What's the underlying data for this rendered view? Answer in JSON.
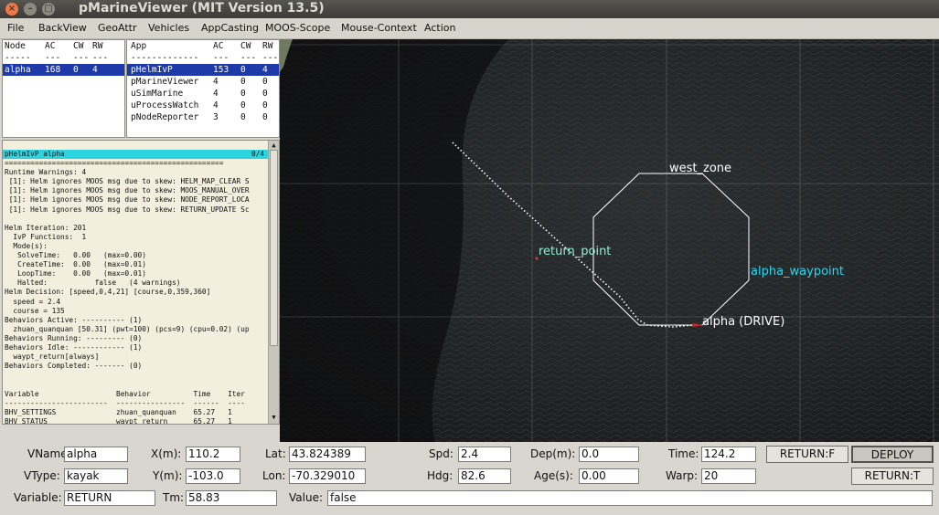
{
  "window": {
    "title": "pMarineViewer (MIT Version 13.5)"
  },
  "menu": [
    "File",
    "BackView",
    "GeoAttr",
    "Vehicles",
    "AppCasting",
    "MOOS-Scope",
    "Mouse-Context",
    "Action"
  ],
  "nodes": {
    "headers": [
      "Node",
      "AC",
      "CW",
      "RW"
    ],
    "divider": [
      "-----",
      "---",
      "---",
      "---"
    ],
    "rows": [
      [
        "alpha",
        "168",
        "0",
        "4"
      ]
    ]
  },
  "apps": {
    "headers": [
      "App",
      "AC",
      "CW",
      "RW"
    ],
    "divider": [
      "-------------",
      "---",
      "---",
      "---"
    ],
    "rows": [
      [
        "pHelmIvP",
        "153",
        "0",
        "4"
      ],
      [
        "pMarineViewer",
        "4",
        "0",
        "0"
      ],
      [
        "uSimMarine",
        "4",
        "0",
        "0"
      ],
      [
        "uProcessWatch",
        "4",
        "0",
        "0"
      ],
      [
        "pNodeReporter",
        "3",
        "0",
        "0"
      ]
    ]
  },
  "report": {
    "header_left": "pHelmIvP alpha",
    "header_right": "0/4",
    "lines": [
      "===================================================",
      "Runtime Warnings: 4",
      " [1]: Helm ignores MOOS msg due to skew: HELM_MAP_CLEAR S",
      " [1]: Helm ignores MOOS msg due to skew: MOOS_MANUAL_OVER",
      " [1]: Helm ignores MOOS msg due to skew: NODE_REPORT_LOCA",
      " [1]: Helm ignores MOOS msg due to skew: RETURN_UPDATE Sc",
      "",
      "Helm Iteration: 201",
      "  IvP Functions:  1",
      "  Mode(s):",
      "   SolveTime:   0.00   (max=0.00)",
      "   CreateTime:  0.00   (max=0.01)",
      "   LoopTime:    0.00   (max=0.01)",
      "   Halted:           false   (4 warnings)",
      "Helm Decision: [speed,0,4,21] [course,0,359,360]",
      "  speed = 2.4",
      "  course = 135",
      "Behaviors Active: ---------- (1)",
      "  zhuan_quanquan [50.31] (pwt=100) (pcs=9) (cpu=0.02) (up",
      "Behaviors Running: --------- (0)",
      "Behaviors Idle: ------------ (1)",
      "  waypt_return[always]",
      "Behaviors Completed: ------- (0)",
      "",
      "",
      "Variable                  Behavior          Time    Iter",
      "------------------------  ----------------  ------  ----",
      "BHV_SETTINGS              zhuan_quanquan    65.27   1",
      "BHV_STATUS                waypt_return      65.27   1"
    ]
  },
  "map": {
    "labels": {
      "zone": "west_zone",
      "return_point": "return_point",
      "waypoint": "alpha_waypoint",
      "vehicle": "alpha (DRIVE)"
    },
    "colors": {
      "zone": "#ffffff",
      "return_point": "#8ff0d0",
      "waypoint": "#22d9f2",
      "vehicle": "#ffffff",
      "vehicle_marker": "#e02020"
    }
  },
  "fields": {
    "vname": {
      "label": "VName:",
      "value": "alpha"
    },
    "vtype": {
      "label": "VType:",
      "value": "kayak"
    },
    "x": {
      "label": "X(m):",
      "value": "110.2"
    },
    "y": {
      "label": "Y(m):",
      "value": "-103.0"
    },
    "lat": {
      "label": "Lat:",
      "value": "43.824389"
    },
    "lon": {
      "label": "Lon:",
      "value": "-70.329010"
    },
    "spd": {
      "label": "Spd:",
      "value": "2.4"
    },
    "hdg": {
      "label": "Hdg:",
      "value": "82.6"
    },
    "dep": {
      "label": "Dep(m):",
      "value": "0.0"
    },
    "age": {
      "label": "Age(s):",
      "value": "0.00"
    },
    "time": {
      "label": "Time:",
      "value": "124.2"
    },
    "warp": {
      "label": "Warp:",
      "value": "20"
    },
    "variable": {
      "label": "Variable:",
      "value": "RETURN"
    },
    "tm": {
      "label": "Tm:",
      "value": "58.83"
    },
    "value": {
      "label": "Value:",
      "value": "false"
    }
  },
  "buttons": {
    "return_f": "RETURN:F",
    "deploy": "DEPLOY",
    "return_t": "RETURN:T"
  }
}
